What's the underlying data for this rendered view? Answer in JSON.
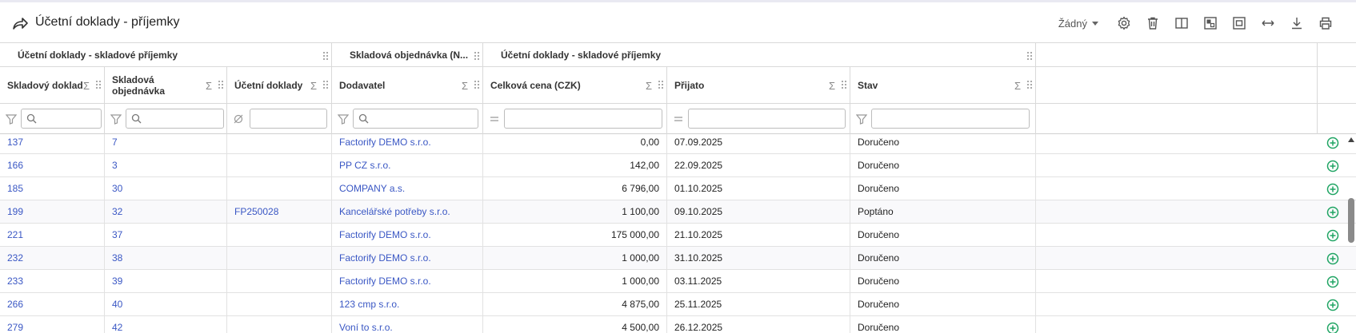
{
  "header": {
    "title": "Účetní doklady - příjemky",
    "selector_value": "Žádný"
  },
  "icons": {
    "share": "share-arrow-icon",
    "settings": "gear-icon",
    "delete": "trash-icon",
    "columns": "columns-icon",
    "layout": "layout-icon",
    "fit": "fit-screen-icon",
    "resize": "horizontal-resize-icon",
    "download": "download-icon",
    "print": "printer-icon"
  },
  "groups": [
    {
      "label": "Účetní doklady - skladové příjemky"
    },
    {
      "label": "Skladová objednávka (N..."
    },
    {
      "label": "Účetní doklady - skladové příjemky"
    }
  ],
  "columns": [
    {
      "label": "Skladový doklad"
    },
    {
      "label": "Skladová objednávka"
    },
    {
      "label": "Účetní doklady"
    },
    {
      "label": "Dodavatel"
    },
    {
      "label": "Celková cena (CZK)"
    },
    {
      "label": "Přijato"
    },
    {
      "label": "Stav"
    }
  ],
  "sigma": "Σ",
  "rows": [
    {
      "doklad": "137",
      "objednavka": "7",
      "ucetni": "",
      "dodavatel": "Factorify DEMO s.r.o.",
      "cena": "0,00",
      "prijato": "07.09.2025",
      "stav": "Doručeno"
    },
    {
      "doklad": "166",
      "objednavka": "3",
      "ucetni": "",
      "dodavatel": "PP CZ s.r.o.",
      "cena": "142,00",
      "prijato": "22.09.2025",
      "stav": "Doručeno"
    },
    {
      "doklad": "185",
      "objednavka": "30",
      "ucetni": "",
      "dodavatel": "COMPANY a.s.",
      "cena": "6 796,00",
      "prijato": "01.10.2025",
      "stav": "Doručeno"
    },
    {
      "doklad": "199",
      "objednavka": "32",
      "ucetni": "FP250028",
      "dodavatel": "Kancelářské potřeby s.r.o.",
      "cena": "1 100,00",
      "prijato": "09.10.2025",
      "stav": "Poptáno"
    },
    {
      "doklad": "221",
      "objednavka": "37",
      "ucetni": "",
      "dodavatel": "Factorify DEMO s.r.o.",
      "cena": "175 000,00",
      "prijato": "21.10.2025",
      "stav": "Doručeno"
    },
    {
      "doklad": "232",
      "objednavka": "38",
      "ucetni": "",
      "dodavatel": "Factorify DEMO s.r.o.",
      "cena": "1 000,00",
      "prijato": "31.10.2025",
      "stav": "Doručeno"
    },
    {
      "doklad": "233",
      "objednavka": "39",
      "ucetni": "",
      "dodavatel": "Factorify DEMO s.r.o.",
      "cena": "1 000,00",
      "prijato": "03.11.2025",
      "stav": "Doručeno"
    },
    {
      "doklad": "266",
      "objednavka": "40",
      "ucetni": "",
      "dodavatel": "123 cmp s.r.o.",
      "cena": "4 875,00",
      "prijato": "25.11.2025",
      "stav": "Doručeno"
    },
    {
      "doklad": "279",
      "objednavka": "42",
      "ucetni": "",
      "dodavatel": "Voní to s.r.o.",
      "cena": "4 500,00",
      "prijato": "26.12.2025",
      "stav": "Doručeno"
    }
  ],
  "colors": {
    "link": "#3a57c4",
    "add": "#1fa463"
  }
}
